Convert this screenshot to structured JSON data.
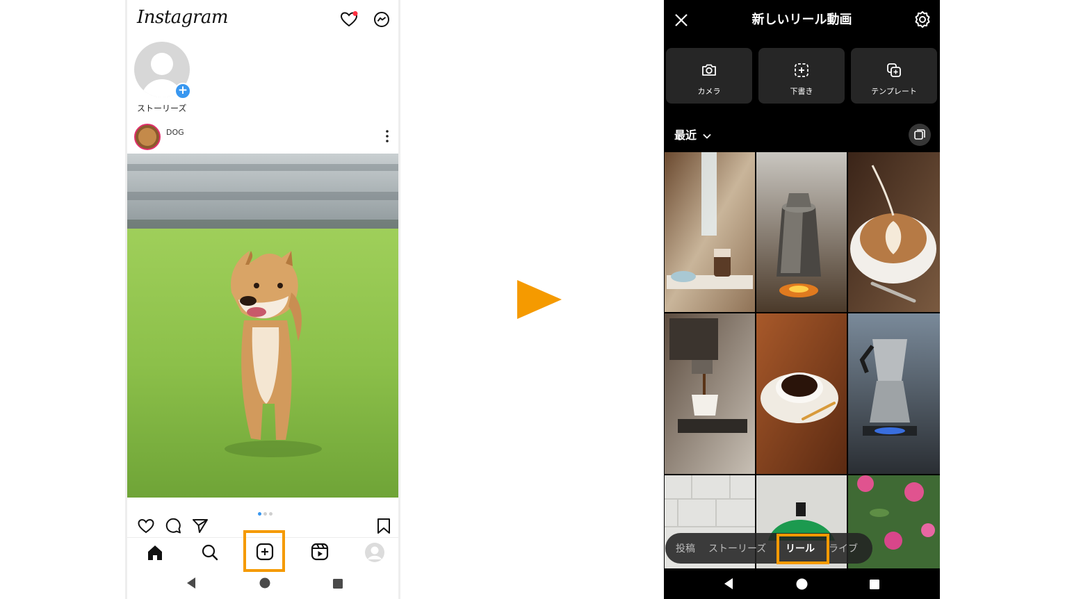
{
  "left_screen": {
    "app_logo": "Instagram",
    "stories": {
      "label": "ストーリーズ"
    },
    "post": {
      "username": "DOG",
      "carousel_pages": 3,
      "carousel_current": 1
    },
    "bottom_nav": [
      "home",
      "search",
      "create",
      "reels",
      "profile"
    ],
    "highlight_color": "#f59a00"
  },
  "arrow": {
    "color": "#f59a00"
  },
  "right_screen": {
    "title": "新しいリール動画",
    "tools": [
      {
        "label": "カメラ",
        "icon": "camera-icon"
      },
      {
        "label": "下書き",
        "icon": "draft-icon"
      },
      {
        "label": "テンプレート",
        "icon": "template-icon"
      }
    ],
    "album": {
      "label": "最近"
    },
    "gallery": [
      "coffee-cafe",
      "metal-kettle",
      "latte-art",
      "espresso-machine",
      "coffee-cup-wood",
      "moka-pot",
      "white-brick",
      "green-kettle",
      "pink-flowers"
    ],
    "modes": {
      "post": "投稿",
      "story": "ストーリーズ",
      "reel": "リール",
      "live": "ライブ"
    },
    "selected_mode": "リール"
  }
}
